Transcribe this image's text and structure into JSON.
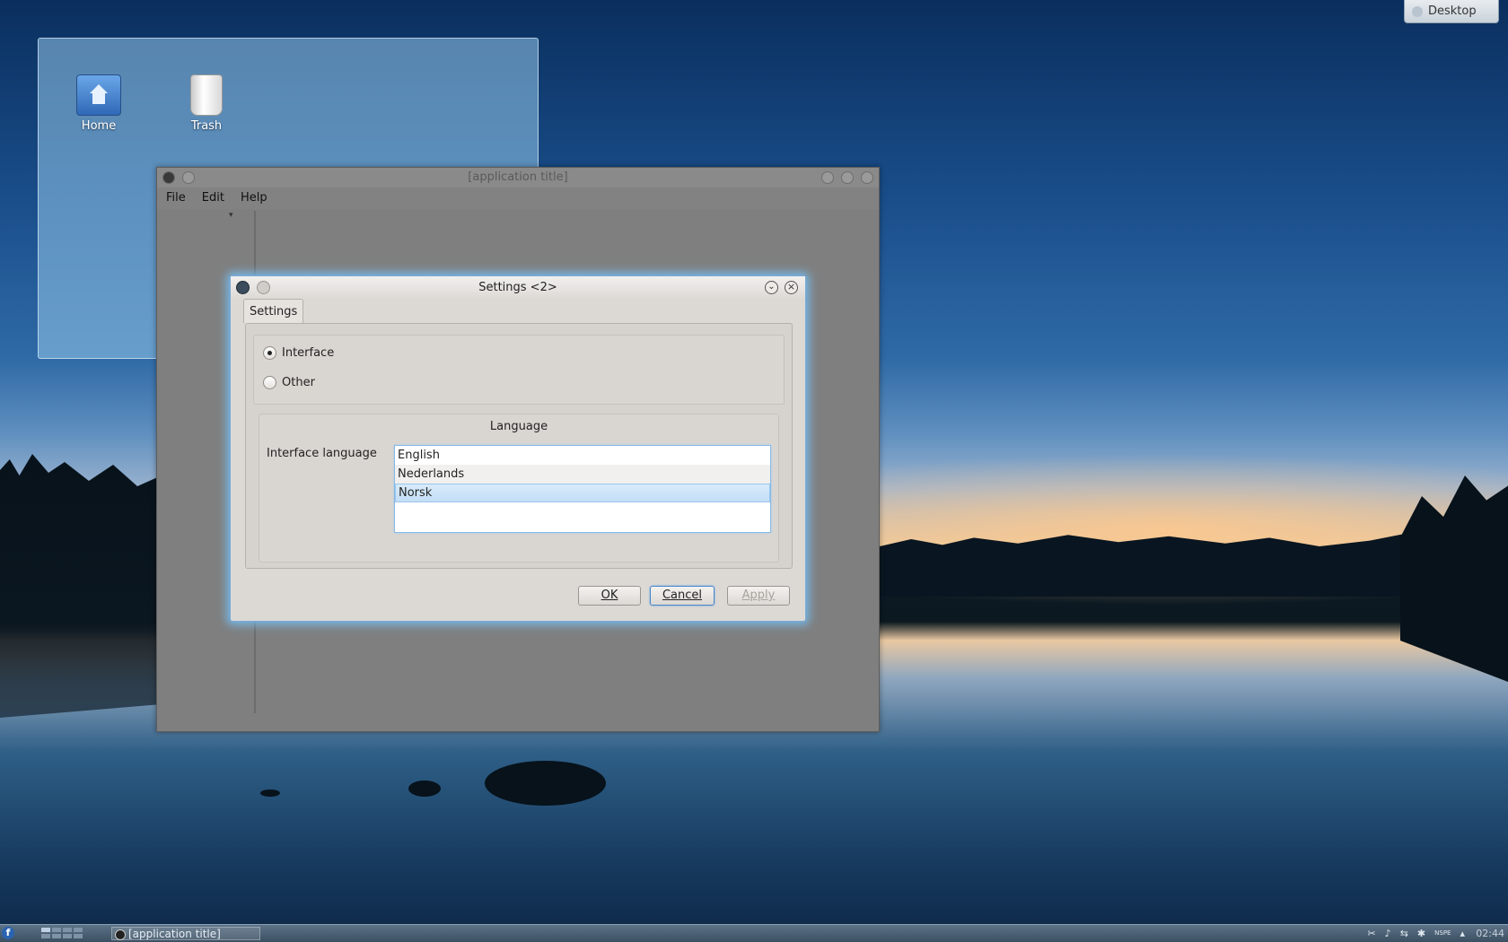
{
  "desktop": {
    "toolbox_label": "Desktop",
    "icons": [
      {
        "label": "Home",
        "icon": "home-folder-icon"
      },
      {
        "label": "Trash",
        "icon": "trash-icon"
      }
    ]
  },
  "app_window": {
    "title": "[application title]",
    "menu": [
      "File",
      "Edit",
      "Help"
    ]
  },
  "dialog": {
    "title": "Settings <2>",
    "tab_label": "Settings",
    "radios": [
      {
        "label": "Interface",
        "checked": true
      },
      {
        "label": "Other",
        "checked": false
      }
    ],
    "language_group_title": "Language",
    "interface_language_label": "Interface language",
    "languages": [
      "English",
      "Nederlands",
      "Norsk"
    ],
    "selected_language": "Norsk",
    "buttons": {
      "ok": "OK",
      "cancel": "Cancel",
      "apply": "Apply"
    }
  },
  "taskbar": {
    "task_label": "[application title]",
    "clock": "02:44",
    "kbd_layout": "NSPE"
  }
}
